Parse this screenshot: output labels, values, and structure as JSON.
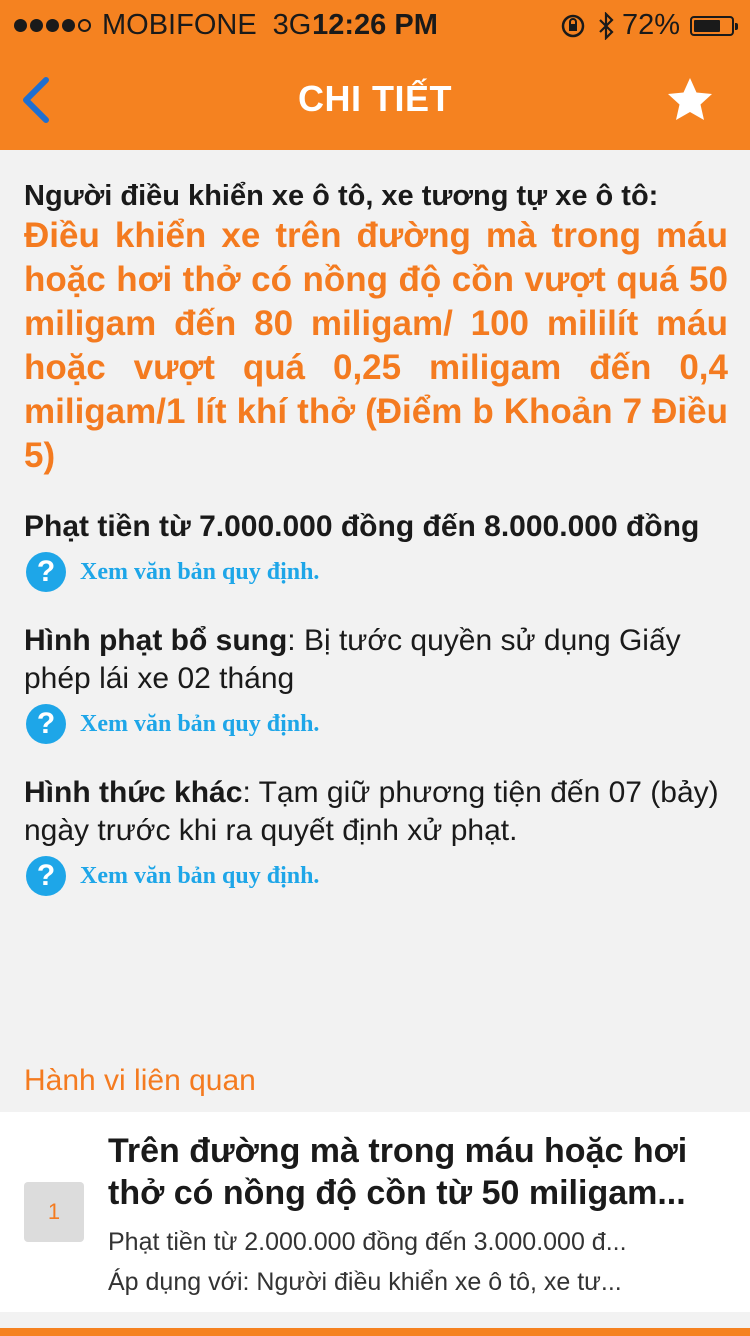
{
  "status_bar": {
    "carrier": "MOBIFONE",
    "network": "3G",
    "time": "12:26 PM",
    "battery_percent": "72%",
    "battery_level": 0.72,
    "signal_dots_filled": 4,
    "signal_dots_total": 5
  },
  "nav": {
    "title": "CHI TIẾT",
    "back_icon": "chevron-left-icon",
    "favorite_icon": "star-icon"
  },
  "detail": {
    "subject": "Người điều khiển xe ô tô, xe tương tự xe ô tô:",
    "violation": "Điều khiển xe trên đường mà trong máu hoặc hơi thở có nồng độ cồn vượt quá 50 miligam đến 80 miligam/ 100 mililít máu hoặc vượt quá 0,25 miligam đến 0,4 miligam/1 lít khí thở (Điểm b Khoản 7 Điều 5)",
    "fine": "Phạt tiền từ 7.000.000 đồng đến 8.000.000 đồng",
    "link_label": "Xem văn bản quy định.",
    "additional_label": "Hình phạt bổ sung",
    "additional_text": ": Bị tước quyền sử dụng Giấy phép lái xe 02 tháng",
    "other_label": "Hình thức khác",
    "other_text": ": Tạm giữ phương tiện đến 07 (bảy) ngày trước khi ra quyết định xử phạt."
  },
  "related": {
    "section_title": "Hành vi liên quan",
    "items": [
      {
        "badge": "1",
        "title": "Trên đường mà trong máu hoặc hơi thở có nồng độ cồn từ 50 miligam...",
        "fine": "Phạt tiền từ 2.000.000 đồng đến 3.000.000 đ...",
        "applies": "Áp dụng với: Người điều khiển xe ô tô, xe tư..."
      }
    ]
  },
  "colors": {
    "brand_orange": "#f58220",
    "violation_orange": "#f47b20",
    "link_blue": "#1ea6e8",
    "back_blue": "#1f6fd1"
  }
}
